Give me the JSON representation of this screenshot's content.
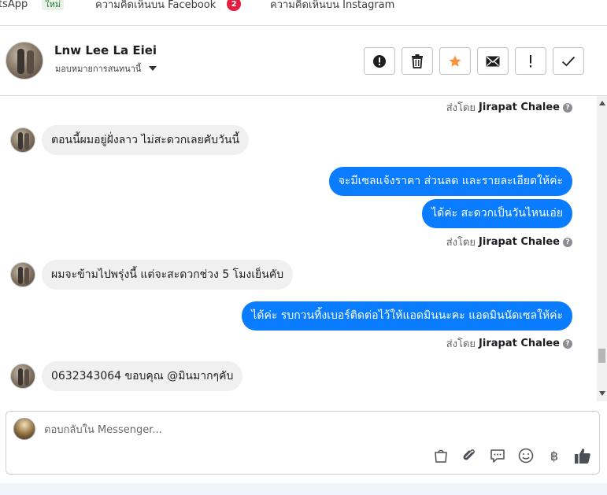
{
  "tabs": [
    {
      "label": "tsApp",
      "badge": "ใหม่"
    },
    {
      "label": "ความคิดเห็นบน Facebook",
      "count": "2"
    },
    {
      "label": "ความคิดเห็นบน Instagram"
    }
  ],
  "header": {
    "contact_name": "Lnw Lee La Eiei",
    "assign_label": "มอบหมายการสนทนานี้"
  },
  "actions": [
    {
      "icon": "alert-circle-icon"
    },
    {
      "icon": "trash-icon"
    },
    {
      "icon": "star-icon"
    },
    {
      "icon": "envelope-icon"
    },
    {
      "icon": "exclamation-icon"
    },
    {
      "icon": "check-icon"
    }
  ],
  "thread": {
    "sent_by_prefix": "ส่งโดย",
    "agent_name": "Jirapat Chalee",
    "messages": [
      {
        "dir": "in",
        "text": "ตอนนี้ผมอยู่ฝั่งลาว ไม่สะดวกเลยคับวันนี้"
      },
      {
        "dir": "out",
        "text": "จะมีเซลแจ้งราคา ส่วนลด และรายละเอียดให้ค่ะ"
      },
      {
        "dir": "out",
        "text": "ได้ค่ะ สะดวกเป็นวันไหนเอ่ย"
      },
      {
        "dir": "in",
        "text": "ผมจะข้ามไปพรุ่งนี้ แต่จะสะดวกช่วง 5 โมงเย็นคับ"
      },
      {
        "dir": "out",
        "text": "ได้ค่ะ รบกวนทิ้งเบอร์ติดต่อไว้ให้แอดมินนะคะ แอดมินนัดเซลให้ค่ะ"
      },
      {
        "dir": "in",
        "text": "0632343064 ขอบคุณ @มินมากๆคับ"
      }
    ]
  },
  "reply": {
    "placeholder": "ตอบกลับใน Messenger...",
    "tools": [
      "shopping-bag-icon",
      "paperclip-icon",
      "chat-bubble-icon",
      "smiley-icon",
      "baht-icon",
      "thumbs-up-icon"
    ]
  },
  "colors": {
    "accent": "#0a7cff",
    "star": "#f7923b",
    "badge_red": "#e41e3f"
  }
}
